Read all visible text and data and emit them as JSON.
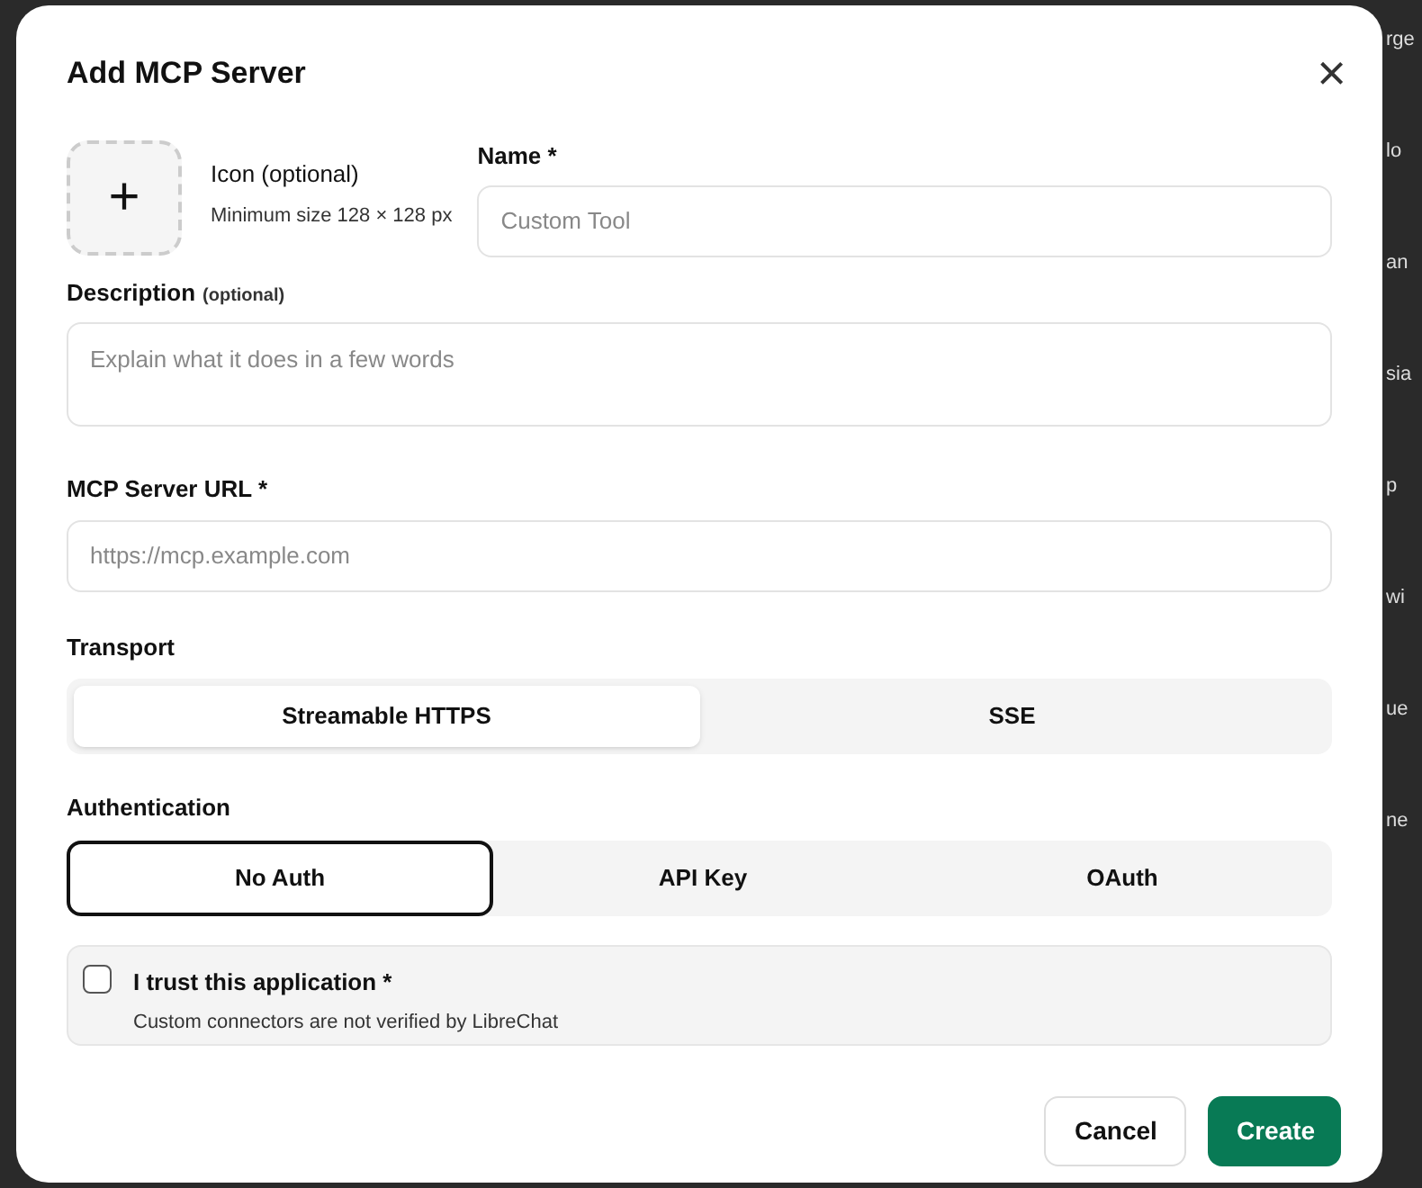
{
  "background_fragments": [
    "rge",
    "lo",
    "an",
    "sia",
    "p",
    "wi",
    "ue",
    "ne"
  ],
  "dialog": {
    "title": "Add MCP Server",
    "close_label": "×"
  },
  "icon_upload": {
    "plus": "+",
    "label": "Icon (optional)",
    "hint": "Minimum size 128 × 128 px"
  },
  "name_field": {
    "label": "Name *",
    "placeholder": "Custom Tool"
  },
  "description_field": {
    "label": "Description",
    "label_note": "(optional)",
    "placeholder": "Explain what it does in a few words"
  },
  "url_field": {
    "label": "MCP Server URL *",
    "placeholder": "https://mcp.example.com"
  },
  "transport": {
    "label": "Transport",
    "options": [
      {
        "label": "Streamable HTTPS",
        "selected": true
      },
      {
        "label": "SSE",
        "selected": false
      }
    ]
  },
  "authentication": {
    "label": "Authentication",
    "options": [
      {
        "label": "No Auth",
        "selected": true
      },
      {
        "label": "API Key",
        "selected": false
      },
      {
        "label": "OAuth",
        "selected": false
      }
    ]
  },
  "trust": {
    "label": "I trust this application *",
    "hint": "Custom connectors are not verified by LibreChat",
    "checked": false
  },
  "buttons": [
    {
      "label": "Cancel",
      "kind": "secondary"
    },
    {
      "label": "Create",
      "kind": "primary"
    }
  ]
}
